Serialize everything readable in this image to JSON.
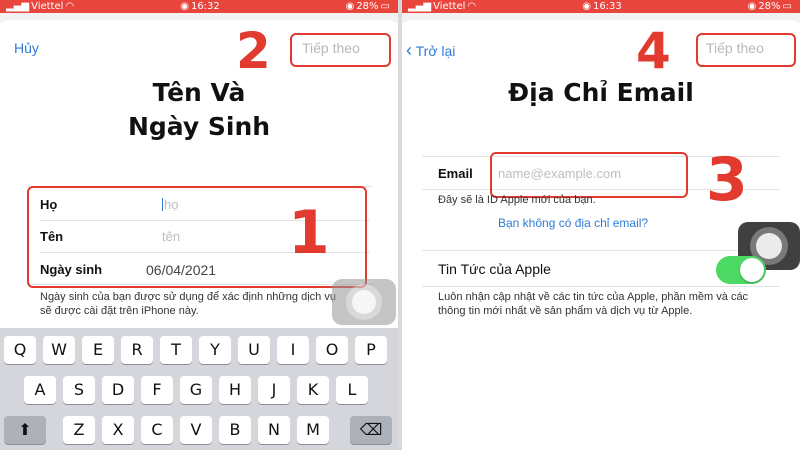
{
  "left": {
    "status": {
      "carrier": "Viettel",
      "time": "16:32",
      "battery": "28%"
    },
    "nav": {
      "cancel_label": "Hủy",
      "next_label": "Tiếp theo"
    },
    "title_line1": "Tên Và",
    "title_line2": "Ngày Sinh",
    "form": [
      {
        "label": "Họ",
        "value": "họ"
      },
      {
        "label": "Tên",
        "value": "tên"
      },
      {
        "label": "Ngày sinh",
        "value": "06/04/2021"
      }
    ],
    "note": "Ngày sinh của bạn được sử dụng để xác định những dịch vụ sẽ được cài đặt trên iPhone này.",
    "annotations": {
      "step_form": "1",
      "step_next": "2"
    },
    "keyboard": {
      "row1": [
        "Q",
        "W",
        "E",
        "R",
        "T",
        "Y",
        "U",
        "I",
        "O",
        "P"
      ],
      "row2": [
        "A",
        "S",
        "D",
        "F",
        "G",
        "H",
        "J",
        "K",
        "L"
      ],
      "row3": [
        "Z",
        "X",
        "C",
        "V",
        "B",
        "N",
        "M"
      ],
      "shift": "⬆",
      "backspace": "⌫"
    }
  },
  "right": {
    "status": {
      "carrier": "Viettel",
      "time": "16:33",
      "battery": "28%"
    },
    "nav": {
      "back_label": "Trở lại",
      "next_label": "Tiếp theo"
    },
    "title": "Địa Chỉ Email",
    "email_label": "Email",
    "email_placeholder": "name@example.com",
    "email_hint": "Đây sẽ là ID Apple mới của bạn.",
    "no_email_link": "Bạn không có địa chỉ email?",
    "news_label": "Tin Tức của Apple",
    "news_toggle_on": true,
    "news_desc": "Luôn nhận cập nhật về các tin tức của Apple, phần mềm và các thông tin mới nhất về sản phẩm và dịch vụ từ Apple.",
    "annotations": {
      "step_email": "3",
      "step_next": "4"
    }
  },
  "colors": {
    "accent": "#2f7bd6",
    "annotation": "#e23a2e",
    "status_bar": "#e8453c",
    "toggle_on": "#4cd964"
  },
  "icons": [
    "signal-icon",
    "wifi-icon",
    "alarm-icon",
    "battery-icon",
    "chevron-left-icon",
    "shift-icon",
    "backspace-icon",
    "assistive-touch-icon"
  ]
}
